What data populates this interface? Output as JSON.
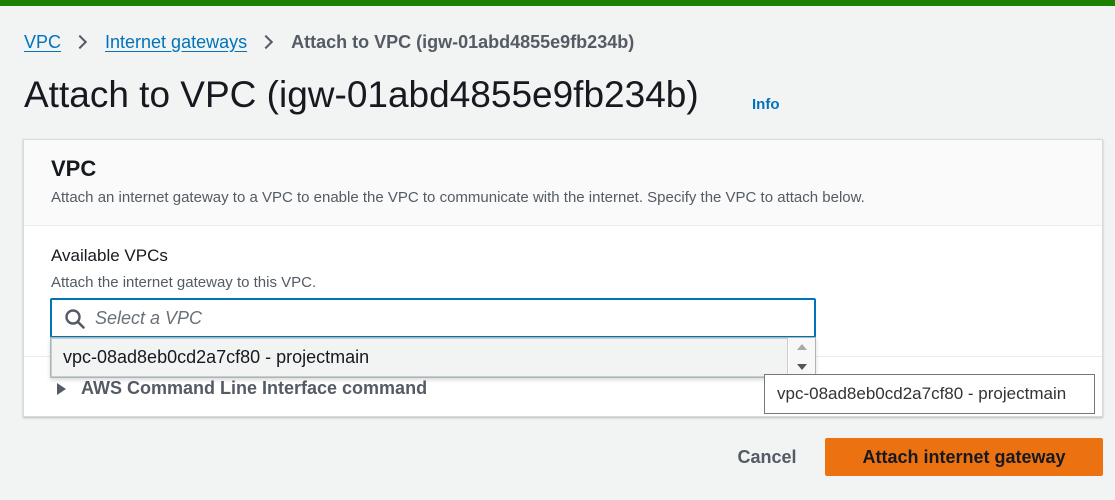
{
  "breadcrumb": {
    "items": [
      {
        "label": "VPC"
      },
      {
        "label": "Internet gateways"
      }
    ],
    "current": "Attach to VPC (igw-01abd4855e9fb234b)"
  },
  "page": {
    "title": "Attach to VPC (igw-01abd4855e9fb234b)",
    "info_label": "Info"
  },
  "panel": {
    "title": "VPC",
    "description": "Attach an internet gateway to a VPC to enable the VPC to communicate with the internet. Specify the VPC to attach below.",
    "field_label": "Available VPCs",
    "field_description": "Attach the internet gateway to this VPC.",
    "search_placeholder": "Select a VPC",
    "search_value": "",
    "cli_label": "AWS Command Line Interface command"
  },
  "dropdown": {
    "options": [
      {
        "label": "vpc-08ad8eb0cd2a7cf80 - projectmain"
      }
    ]
  },
  "tooltip": {
    "text": "vpc-08ad8eb0cd2a7cf80 - projectmain"
  },
  "footer": {
    "cancel_label": "Cancel",
    "submit_label": "Attach internet gateway"
  },
  "colors": {
    "top_bar": "#1d8102",
    "link": "#0073bb",
    "primary": "#ec7211",
    "focus": "#0073bb"
  },
  "icons": [
    "chevron-right-icon",
    "search-icon",
    "caret-right-icon",
    "scroll-up-icon",
    "scroll-down-icon"
  ]
}
